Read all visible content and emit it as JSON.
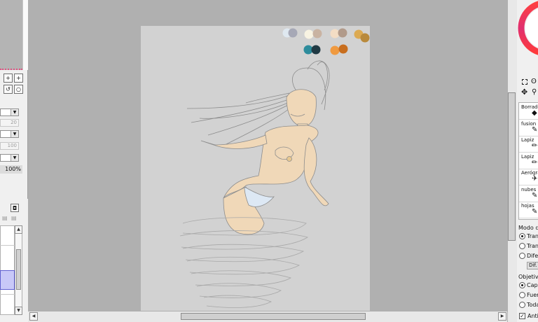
{
  "left_panel": {
    "size_min": "20",
    "size_max": "100",
    "opacity": "100%"
  },
  "right_panel": {
    "tools": [
      {
        "label": "Borrado",
        "icon": "eraser-icon"
      },
      {
        "label": "fusion",
        "icon": "blend-brush-icon"
      },
      {
        "label": "Lapiz",
        "icon": "pencil-icon"
      },
      {
        "label": "Lapiz",
        "icon": "pencil-icon"
      },
      {
        "label": "Aerógra",
        "icon": "airbrush-icon"
      },
      {
        "label": "nubes",
        "icon": "brush-icon"
      },
      {
        "label": "hojas",
        "icon": "brush-icon"
      }
    ],
    "blend_mode_label": "Modo de",
    "blend_options": [
      "Tran",
      "Tran",
      "Difer"
    ],
    "blend_selected": 0,
    "dif_button": "Dif.",
    "target_label": "Objetivo",
    "target_options": [
      "Capa",
      "Fuer",
      "Toda"
    ],
    "target_selected": 0,
    "antialias_label": "Anti-"
  },
  "canvas": {
    "palette_colors": [
      "#dfe8f0",
      "#a6a8b6",
      "#f8f3e2",
      "#c9b3a2",
      "#f3ddc4",
      "#b19a8a",
      "#dcaa52",
      "#b98a3c",
      "#2d8c9c",
      "#203a44",
      "#f09a40",
      "#c86e1e"
    ],
    "skin_color": "#f0d8b8",
    "swimsuit_color": "#dde8f4",
    "line_color": "#8c8c8c"
  }
}
